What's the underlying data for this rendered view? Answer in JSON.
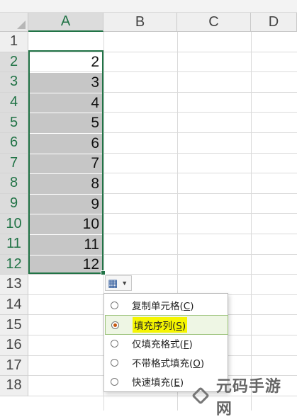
{
  "sheet": {
    "columns": [
      "A",
      "B",
      "C",
      "D"
    ],
    "selected_column": "A",
    "rows": [
      "1",
      "2",
      "3",
      "4",
      "5",
      "6",
      "7",
      "8",
      "9",
      "10",
      "11",
      "12",
      "13",
      "14",
      "15",
      "16",
      "17",
      "18"
    ],
    "column_a_values": [
      "",
      "2",
      "3",
      "4",
      "5",
      "6",
      "7",
      "8",
      "9",
      "10",
      "11",
      "12"
    ],
    "selection": "A2:A12"
  },
  "autofill": {
    "icon": "autofill-options-icon",
    "caret": "chevron-down-icon"
  },
  "menu": {
    "items": [
      {
        "label": "复制单元格",
        "hotkey": "C",
        "selected": false
      },
      {
        "label": "填充序列",
        "hotkey": "S",
        "selected": true
      },
      {
        "label": "仅填充格式",
        "hotkey": "F",
        "selected": false
      },
      {
        "label": "不带格式填充",
        "hotkey": "O",
        "selected": false
      },
      {
        "label": "快速填充",
        "hotkey": "E",
        "selected": false
      }
    ]
  },
  "watermark": {
    "text": "元码手游网"
  },
  "colors": {
    "accent": "#217346",
    "selection_fill": "#c6c6c6",
    "highlight": "#f5f500"
  }
}
